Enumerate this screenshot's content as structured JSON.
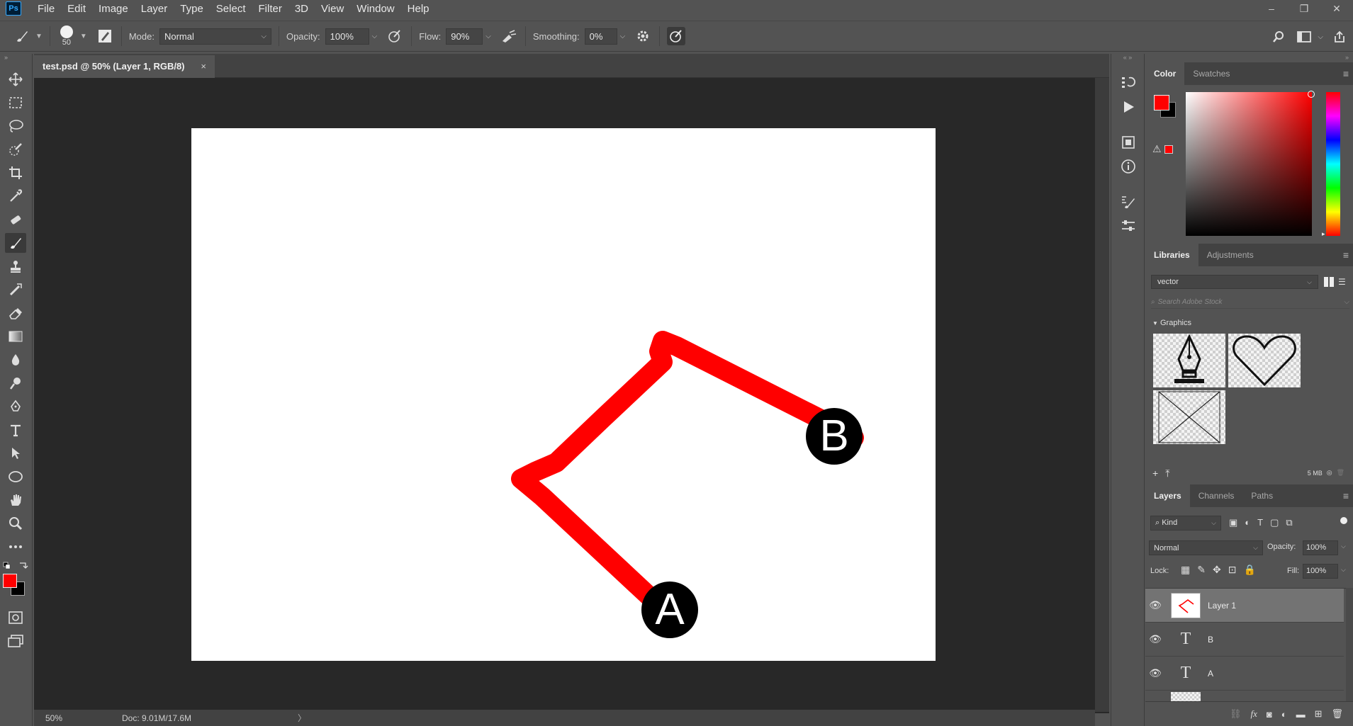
{
  "app": {
    "logo": "Ps"
  },
  "menu": [
    "File",
    "Edit",
    "Image",
    "Layer",
    "Type",
    "Select",
    "Filter",
    "3D",
    "View",
    "Window",
    "Help"
  ],
  "window_controls": {
    "minimize": "–",
    "restore": "❐",
    "close": "✕"
  },
  "options": {
    "brush_size": "50",
    "mode_label": "Mode:",
    "mode_value": "Normal",
    "opacity_label": "Opacity:",
    "opacity_value": "100%",
    "flow_label": "Flow:",
    "flow_value": "90%",
    "smoothing_label": "Smoothing:",
    "smoothing_value": "0%"
  },
  "document": {
    "tab_title": "test.psd @ 50% (Layer 1, RGB/8)",
    "tab_close": "×",
    "label_a": "A",
    "label_b": "B",
    "stroke_color": "#ff0000"
  },
  "status": {
    "zoom": "50%",
    "doc_info": "Doc: 9.01M/17.6M",
    "arrow": "〉"
  },
  "colors": {
    "foreground": "#ff0000",
    "background": "#000000"
  },
  "color_panel": {
    "tabs": [
      "Color",
      "Swatches"
    ]
  },
  "libraries_panel": {
    "tabs": [
      "Libraries",
      "Adjustments"
    ],
    "library_name": "vector",
    "search_placeholder": "Search Adobe Stock",
    "graphics_label": "Graphics",
    "size": "5 MB"
  },
  "layers_panel": {
    "tabs": [
      "Layers",
      "Channels",
      "Paths"
    ],
    "filter_kind": "Kind",
    "blend_mode": "Normal",
    "opacity_label": "Opacity:",
    "opacity_value": "100%",
    "lock_label": "Lock:",
    "fill_label": "Fill:",
    "fill_value": "100%",
    "layers": [
      {
        "name": "Layer 1",
        "type": "pixel",
        "selected": true
      },
      {
        "name": "B",
        "type": "text",
        "selected": false
      },
      {
        "name": "A",
        "type": "text",
        "selected": false
      }
    ]
  }
}
